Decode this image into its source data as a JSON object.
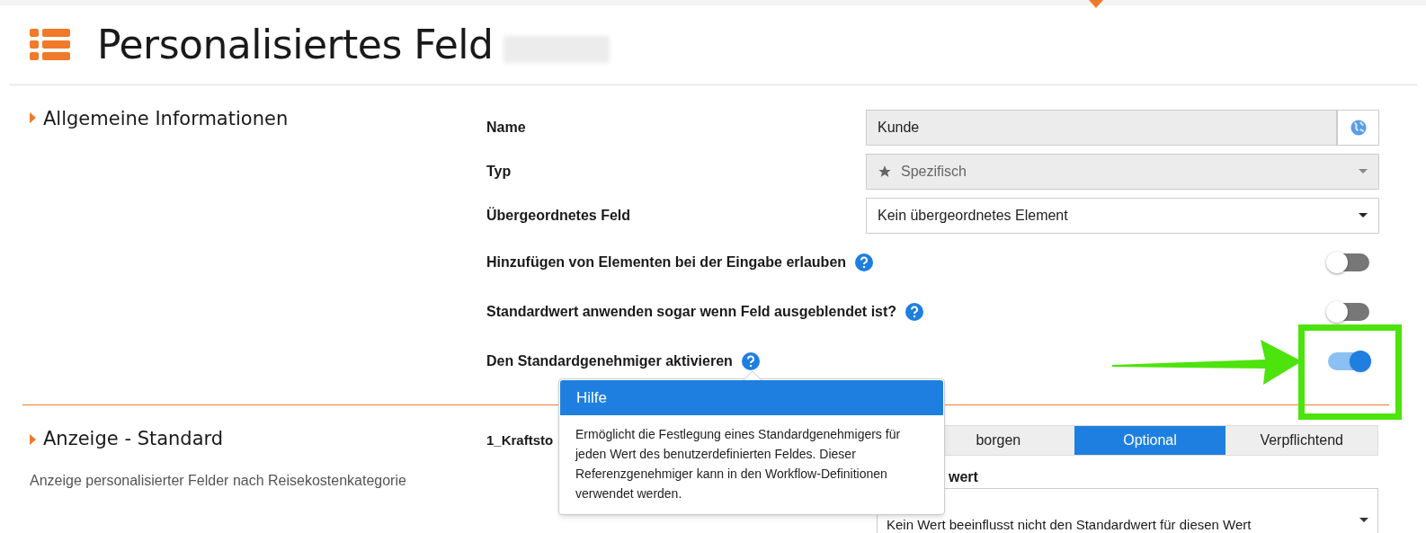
{
  "header": {
    "title": "Personalisiertes Feld"
  },
  "section_general": {
    "title": "Allgemeine Informationen",
    "fields": [
      {
        "kind": "text",
        "label": "Name",
        "value": "Kunde",
        "disabled": true
      },
      {
        "kind": "select",
        "label": "Typ",
        "value": "Spezifisch",
        "disabled": true
      },
      {
        "kind": "select",
        "label": "Übergeordnetes Feld",
        "value": "Kein übergeordnetes Element",
        "disabled": false
      },
      {
        "kind": "toggle",
        "label": "Hinzufügen von Elementen bei der Eingabe erlauben",
        "on": false
      },
      {
        "kind": "toggle",
        "label": "Standardwert anwenden sogar wenn Feld ausgeblendet ist?",
        "on": false
      },
      {
        "kind": "toggle",
        "label": "Den Standardgenehmiger aktivieren",
        "on": true
      }
    ]
  },
  "section_display": {
    "title": "Anzeige - Standard",
    "description": "Anzeige personalisierter Felder nach Reisekostenkategorie",
    "row_label": "1_Kraftsto",
    "options": [
      {
        "label": "borgen",
        "selected": false
      },
      {
        "label": "Optional",
        "selected": true
      },
      {
        "label": "Verpflichtend",
        "selected": false
      }
    ],
    "default_label": "wert",
    "default_value": "Kein Wert beeinflusst nicht den Standardwert für diesen Wert"
  },
  "tooltip": {
    "title": "Hilfe",
    "text": "Ermöglicht die Festlegung eines Standardgenehmigers für jeden Wert des benutzerdefinierten Feldes. Dieser Referenzgenehmiger kann in den Workflow-Definitionen verwendet werden."
  }
}
